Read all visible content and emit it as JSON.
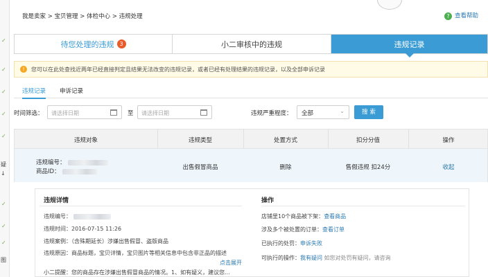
{
  "breadcrumb": [
    "我是卖家",
    "宝贝管理",
    "体检中心",
    "违规处理"
  ],
  "breadcrumb_sep": ">",
  "help_label": "查看帮助",
  "tabs": [
    {
      "label": "待您处理的违规",
      "badge": "3"
    },
    {
      "label": "小二审核中的违规"
    },
    {
      "label": "违规记录"
    }
  ],
  "notice": "您可以在此处查找近两年已经直接判定且结果无法改变的违规记录，或者已经有处理结果的违规记录，以及全部申诉记录",
  "subtabs": [
    "违规记录",
    "申诉记录"
  ],
  "filter": {
    "time_label": "时间筛选：",
    "date_placeholder_1": "请选择日期",
    "date_to": "至",
    "date_placeholder_2": "请选择日期",
    "severity_label": "违规严重程度：",
    "severity_value": "全部",
    "search_button": "搜 索"
  },
  "table": {
    "headers": [
      "违规对象",
      "违规类型",
      "处置方式",
      "扣分分值",
      "操作"
    ],
    "row": {
      "object_line1": "违规编号：",
      "object_line2": "商品ID：",
      "type": "出售假冒商品",
      "action": "删除",
      "score": "售假违规 扣24分",
      "op": "收起"
    }
  },
  "detail": {
    "left_title": "违规详情",
    "lines": [
      "违规编号：",
      "违规时间：2016-07-15 11:26",
      "违规案例：（含殊期延长）涉嫌出售假冒、盗版商品",
      "违规原因：商品标题，宝贝详情，宝贝图片等相关信息中包含非正品的描述",
      "小二提醒：您的商品存在涉嫌出售假冒商品的情况。1、如有疑义，建议您..."
    ],
    "expand": "点击展开",
    "right_title": "操作",
    "right_lines": [
      {
        "text": "店铺里10个商品被下架：",
        "link": "查看商品"
      },
      {
        "text": "涉及多个被处置的订单：",
        "link": "查看订单"
      },
      {
        "text": "已执行的处罚：",
        "link": "申诉失败"
      },
      {
        "text": "可执行的操作：",
        "link": "我有疑问",
        "tail": " 如您对处罚有疑问，请咨询"
      }
    ]
  },
  "left_edge_glyphs": [
    "✓",
    "✓",
    "✓",
    "✓",
    "✓",
    "疑",
    "↓",
    "✓",
    "✓",
    "✓",
    "图"
  ],
  "colors": {
    "accent": "#3a9bd5",
    "badge": "#e95b2a",
    "notice_bg": "#fffbe6",
    "link": "#2a7ab0"
  }
}
